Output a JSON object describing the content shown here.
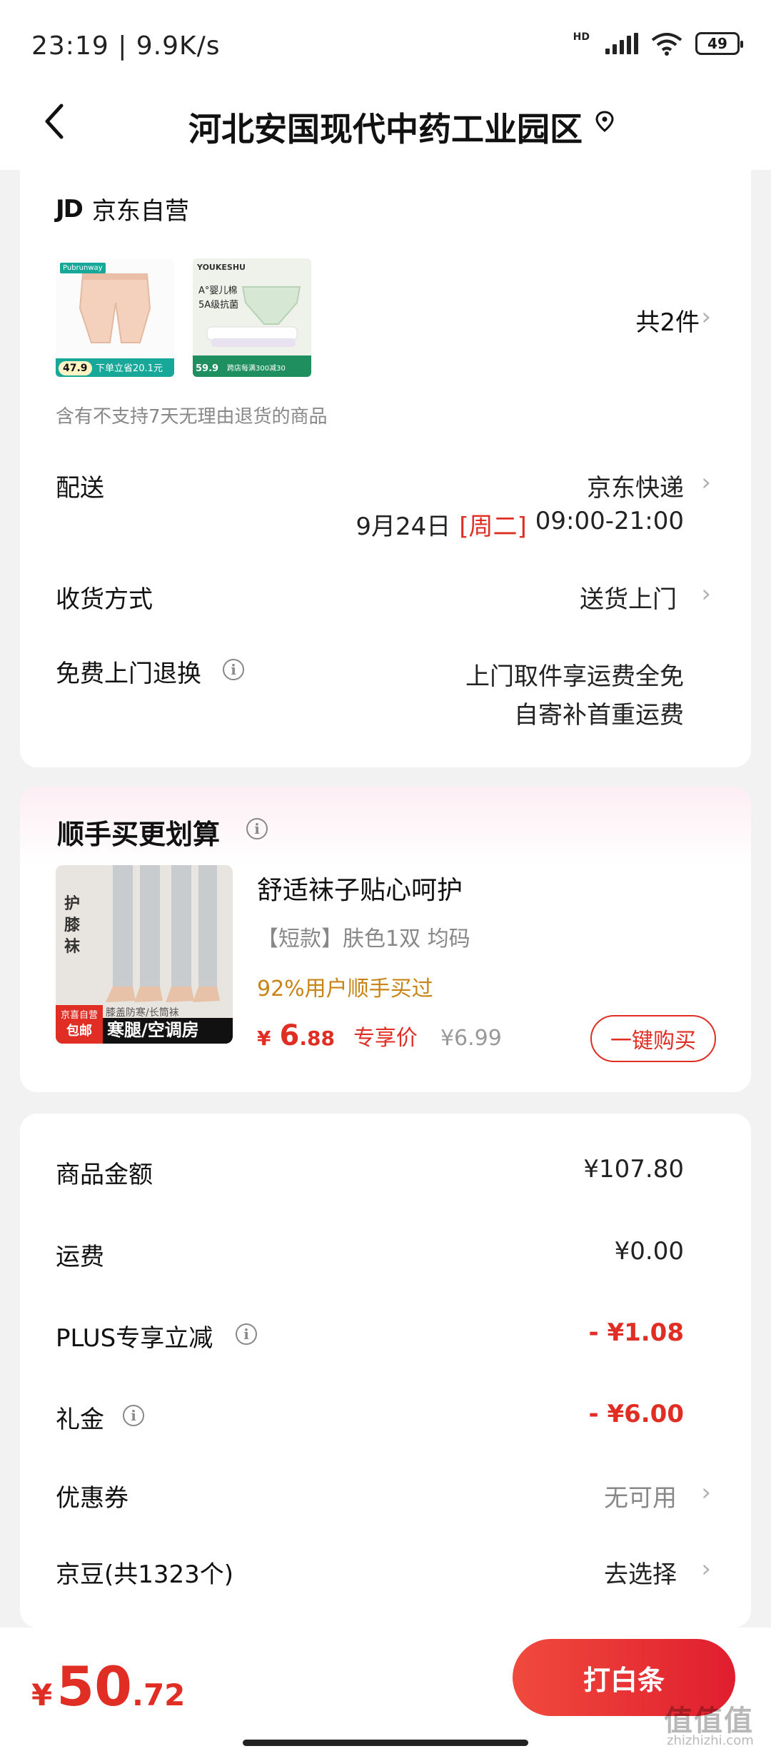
{
  "status_bar": {
    "time": "23:19 | 9.9K/s",
    "hd": "HD",
    "battery": "49"
  },
  "header": {
    "title": "河北安国现代中药工业园区"
  },
  "shipment": {
    "seller_logo": "JD",
    "seller_name": "京东自营",
    "item_count": "共2件",
    "thumb1": {
      "brand": "Pubrunway",
      "price": "47.9",
      "promo": "下单立省20.1元"
    },
    "thumb2": {
      "brand": "YOUKESHU",
      "line1": "A°婴儿棉",
      "line2": "5A级抗菌",
      "price": "59.9",
      "promo": "跨店每满300减30"
    },
    "notice": "含有不支持7天无理由退货的商品"
  },
  "delivery": {
    "label": "配送",
    "carrier": "京东快递",
    "date": "9月24日",
    "weekday": "[周二]",
    "window": "09:00-21:00"
  },
  "receive": {
    "label": "收货方式",
    "value": "送货上门"
  },
  "return": {
    "label": "免费上门退换",
    "line1": "上门取件享运费全免",
    "line2": "自寄补首重运费"
  },
  "upsell": {
    "title": "顺手买更划算",
    "product_name": "舒适袜子贴心呵护",
    "spec": "【短款】肤色1双   均码",
    "stat": "92%用户顺手买过",
    "price_currency": "¥",
    "price_int": "6",
    "price_dec": ".88",
    "price_tag": "专享价",
    "orig_price": "¥6.99",
    "buy_label": "一键购买",
    "img_text_top": "护膝袜",
    "img_badge": "京喜自营",
    "img_badge2": "包邮",
    "img_sub": "膝盖防寒/长筒袜",
    "img_banner": "寒腿/空调房"
  },
  "summary": [
    {
      "label": "商品金额",
      "value": "¥107.80",
      "info": false,
      "red": false,
      "chevron": false
    },
    {
      "label": "运费",
      "value": "¥0.00",
      "info": false,
      "red": false,
      "chevron": false
    },
    {
      "label": "PLUS专享立减",
      "value": "- ¥1.08",
      "info": true,
      "red": true,
      "chevron": false
    },
    {
      "label": "礼金",
      "value": "- ¥6.00",
      "info": true,
      "red": true,
      "chevron": false
    },
    {
      "label": "优惠券",
      "value": "无可用",
      "info": false,
      "red": false,
      "chevron": true
    },
    {
      "label": "京豆(共1323个)",
      "value": "去选择",
      "info": false,
      "red": false,
      "chevron": true
    }
  ],
  "footer": {
    "currency": "¥",
    "total_int": "50",
    "total_dec": ".72",
    "pay_label": "打白条",
    "watermark": "值值值",
    "watermark_sub": "zhizhizhi.com"
  },
  "colors": {
    "accent_red": "#e02e24",
    "stat_orange": "#c88416"
  }
}
